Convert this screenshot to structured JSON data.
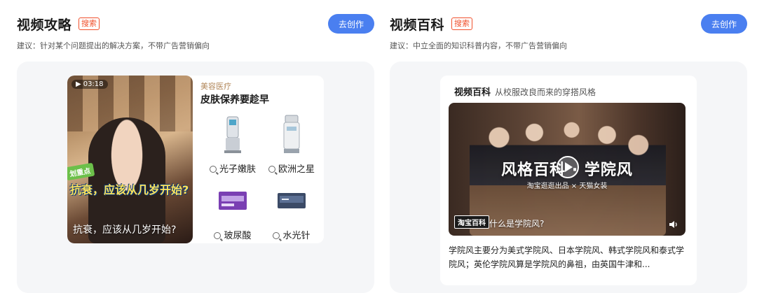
{
  "left": {
    "title": "视频攻略",
    "tag": "搜索",
    "button": "去创作",
    "subtitle": "建议：针对某个问题提出的解决方案，不带广告营销偏向",
    "preview": {
      "duration": "03:18",
      "badge": "划重点",
      "overlay_text": "抗衰，应该从几岁开始?",
      "caption": "抗衰，应该从几岁开始?",
      "category": "美容医疗",
      "headline": "皮肤保养要趁早",
      "products": [
        {
          "label": "光子嫩肤",
          "icon": "laser-machine-icon"
        },
        {
          "label": "欧洲之星",
          "icon": "beauty-device-icon"
        },
        {
          "label": "玻尿酸",
          "icon": "hyaluronic-box-icon"
        },
        {
          "label": "水光针",
          "icon": "injection-box-icon"
        }
      ]
    }
  },
  "right": {
    "title": "视频百科",
    "tag": "搜索",
    "button": "去创作",
    "subtitle": "建议：中立全面的知识科普内容，不带广告营销偏向",
    "preview": {
      "brand": "视频百科",
      "topic": "从校服改良而来的穿搭风格",
      "banner": "风格百科 · 学院风",
      "banner_sub": "淘宝逛逛出品 × 天猫女装",
      "corner_badge": "淘宝百科",
      "question": "什么是学院风?",
      "description": "学院风主要分为美式学院风、日本学院风、韩式学院风和泰式学院风；英伦学院风算是学院风的鼻祖，由英国牛津和..."
    }
  },
  "colors": {
    "accent": "#4a7ff0",
    "tag": "#f0502c",
    "category": "#b2875a"
  }
}
